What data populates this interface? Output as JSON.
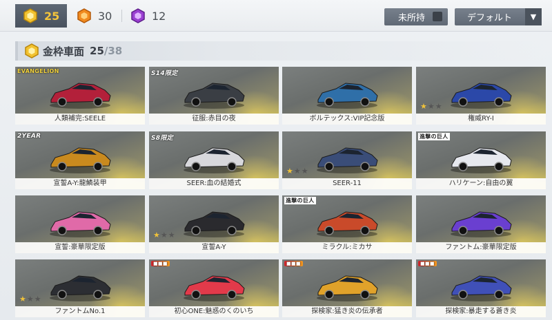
{
  "currencies": [
    {
      "value": "25",
      "icon": "gold-hex-icon",
      "color": "#f2c230"
    },
    {
      "value": "30",
      "icon": "orange-hex-icon",
      "color": "#f08a1e"
    },
    {
      "value": "12",
      "icon": "purple-hex-icon",
      "color": "#9a3fd1"
    }
  ],
  "filters": {
    "unowned_label": "未所持",
    "sort_label": "デフォルト"
  },
  "section": {
    "title": "金枠車面",
    "count": "25",
    "total": "/38"
  },
  "cars": [
    {
      "name": "人類補完:SEELE",
      "tag": "EVANGELION",
      "stars": 0,
      "color": "#b3203a"
    },
    {
      "name": "征服:赤目の夜",
      "tag": "S14限定",
      "stars": 0,
      "color": "#3a3e44"
    },
    {
      "name": "ボルテックス:VIP記念版",
      "tag": "",
      "stars": 0,
      "color": "#2f6fa8"
    },
    {
      "name": "権威RY-I",
      "tag": "",
      "stars": 1,
      "color": "#2b48a8"
    },
    {
      "name": "宣誓A-Y:龍鱗装甲",
      "tag": "2YEAR",
      "stars": 0,
      "color": "#c98a1e"
    },
    {
      "name": "SEER:血の結婚式",
      "tag": "S8限定",
      "stars": 0,
      "color": "#d8d8dc"
    },
    {
      "name": "SEER-11",
      "tag": "",
      "stars": 1,
      "color": "#3a4d78"
    },
    {
      "name": "ハリケーン:自由の翼",
      "tag": "進撃の巨人",
      "stars": 0,
      "color": "#e6e8ee"
    },
    {
      "name": "宣誓:豪華限定版",
      "tag": "",
      "stars": 0,
      "color": "#e06aa8"
    },
    {
      "name": "宣誓A-Y",
      "tag": "",
      "stars": 1,
      "color": "#2a2a2e"
    },
    {
      "name": "ミラクル:ミカサ",
      "tag": "進撃の巨人",
      "stars": 0,
      "color": "#c94a2a"
    },
    {
      "name": "ファントム:豪華限定版",
      "tag": "",
      "stars": 0,
      "color": "#6a3fd0"
    },
    {
      "name": "ファントムNo.1",
      "tag": "",
      "stars": 1,
      "color": "#2c2e33"
    },
    {
      "name": "初心ONE:魅惑のくのいち",
      "tag": "logo",
      "stars": 0,
      "color": "#e23a4a"
    },
    {
      "name": "探検家:猛き炎の伝承者",
      "tag": "logo",
      "stars": 0,
      "color": "#e0a22a"
    },
    {
      "name": "探検家:暴走する蒼き炎",
      "tag": "logo",
      "stars": 0,
      "color": "#4050b8"
    }
  ]
}
